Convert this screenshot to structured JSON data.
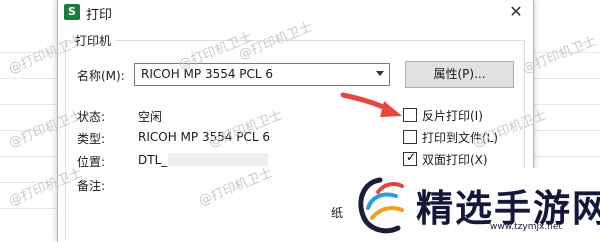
{
  "dialog": {
    "title": "打印",
    "app_icon_letter": "S",
    "close_glyph": "✕"
  },
  "printer_group": {
    "legend": "打印机",
    "name_label": "名称(M):",
    "name_value": "RICOH MP 3554 PCL 6",
    "properties_button": "属性(P)...",
    "status_label": "状态:",
    "status_value": "空闲",
    "type_label": "类型:",
    "type_value": "RICOH MP 3554 PCL 6",
    "location_label": "位置:",
    "location_value": "DTL_",
    "comment_label": "备注:",
    "paper_partial": "纸"
  },
  "options": [
    {
      "label": "反片打印(I)",
      "checked": false
    },
    {
      "label": "打印到文件(L)",
      "checked": false
    },
    {
      "label": "双面打印(X)",
      "checked": true
    }
  ],
  "watermark": {
    "text": "@打印机卫士"
  },
  "badge": {
    "title": "精选手游网",
    "url": "www.tzymjx.net"
  },
  "colors": {
    "arrow": "#e8463c",
    "badge_text": "#16163a",
    "app_icon": "#1f7a3f"
  }
}
